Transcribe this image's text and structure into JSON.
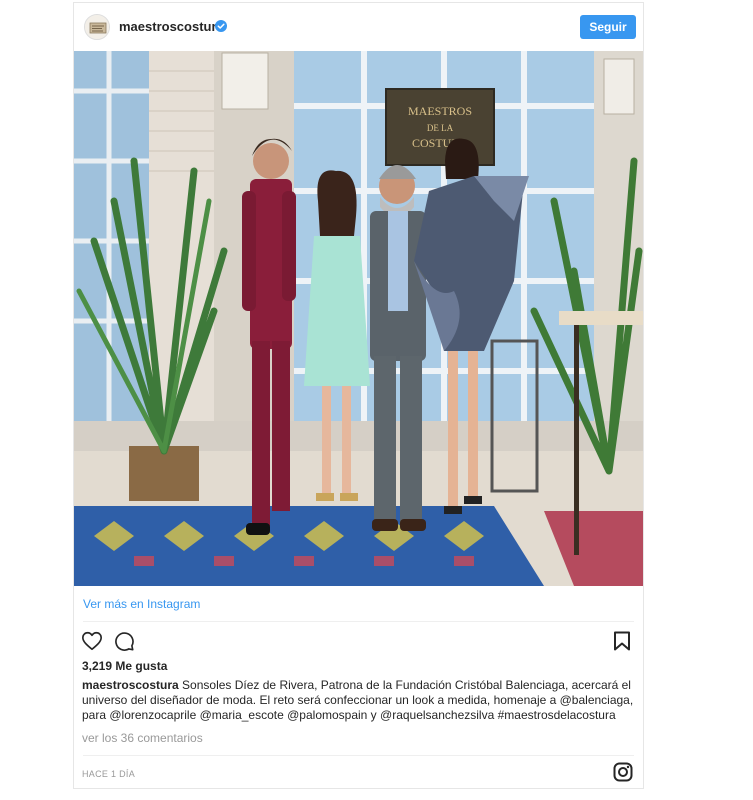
{
  "post": {
    "username": "maestroscostura",
    "verified_icon": "verified-badge-icon",
    "follow_label": "Seguir",
    "photo_sign_text": [
      "MAESTROS",
      "DE LA",
      "COSTURA"
    ],
    "view_more_label": "Ver más en Instagram",
    "likes": "3,219 Me gusta",
    "caption_user": "maestroscostura",
    "caption_lines": [
      " Sonsoles Díez de Rivera, Patrona de la Fundación Cristóbal Balenciaga, acercará el",
      "universo del diseñador de moda. El reto será confeccionar un look a medida, homenaje a @balenciaga,",
      "para @lorenzocaprile @maria_escote @palomospain y @raquelsanchezsilva #maestrosdelacostura"
    ],
    "comments_link": "ver los 36 comentarios",
    "timestamp": "HACE 1 DÍA",
    "icons": [
      "heart-icon",
      "comment-icon",
      "bookmark-icon",
      "instagram-icon"
    ],
    "colors": {
      "accent": "#3897f0",
      "text": "#262626",
      "muted": "#999999",
      "border": "#e6e6e6"
    }
  }
}
